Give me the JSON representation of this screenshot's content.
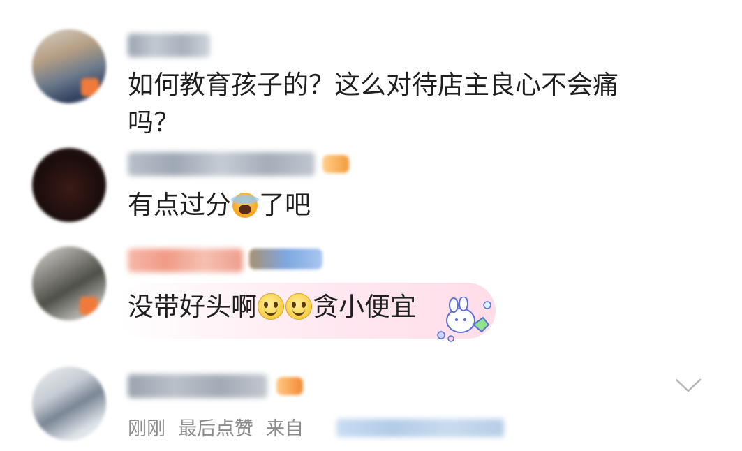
{
  "comments": [
    {
      "text_line1": "如何教育孩子的？这么对待店主良心不会痛",
      "text_line2": "吗？"
    },
    {
      "text_before": "有点过分",
      "emoji": "scream-emoji",
      "text_after": "了吧"
    },
    {
      "text_before": "没带好头啊",
      "emojis": [
        "smile-emoji",
        "smile-emoji"
      ],
      "text_after": "贪小便宜",
      "sticker": "bunny-sticker"
    },
    {
      "time": "刚刚",
      "like_label": "最后点赞",
      "source_prefix": "来自"
    }
  ],
  "icons": {
    "expand": "chevron-down-icon"
  },
  "colors": {
    "bubble": "#ffe8f1",
    "meta_text": "#8c8c8c",
    "badge": "#f07a3a"
  }
}
